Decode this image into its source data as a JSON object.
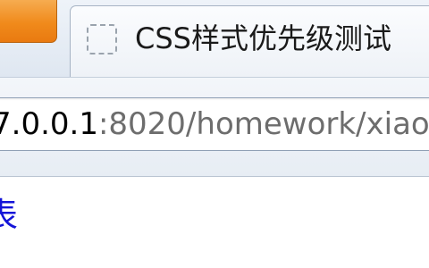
{
  "browser": {
    "tabs": [
      {
        "label": ""
      },
      {
        "label": "CSS样式优先级测试"
      }
    ],
    "address": {
      "host": "7.0.0.1",
      "rest": ":8020/homework/xiao"
    }
  },
  "page": {
    "link_text": "表"
  },
  "colors": {
    "link": "#1414d8",
    "url_host": "#000000",
    "url_rest": "#6d6d6d",
    "tab_orange": "#f08a1b"
  },
  "icons": {
    "favicon": "page-placeholder-icon"
  }
}
